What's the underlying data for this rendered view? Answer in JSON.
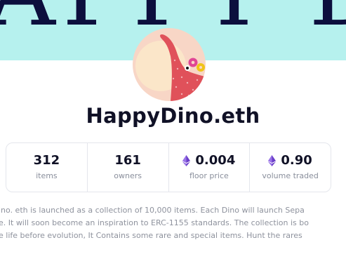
{
  "banner": {
    "text": "APPY DIN"
  },
  "collection": {
    "title": "HappyDino.eth"
  },
  "stats": [
    {
      "value": "312",
      "label": "items",
      "icon": ""
    },
    {
      "value": "161",
      "label": "owners",
      "icon": ""
    },
    {
      "value": "0.004",
      "label": "floor price",
      "icon": "ethereum-icon"
    },
    {
      "value": "0.90",
      "label": "volume traded",
      "icon": "ethereum-icon"
    }
  ],
  "description": {
    "lines": [
      "ino. eth is launched as a collection of 10,000 items. Each Dino will launch Sepa",
      "e. It will soon become an inspiration to ERC-1155 standards. The collection is bo",
      "e life before evolution, It Contains some rare and special items. Hunt the rares"
    ]
  },
  "colors": {
    "banner_bg": "#b6f1ee",
    "banner_text": "#0c0f3d",
    "eth_purple": "#6b3fc9",
    "dino_pink": "#e0515a"
  }
}
